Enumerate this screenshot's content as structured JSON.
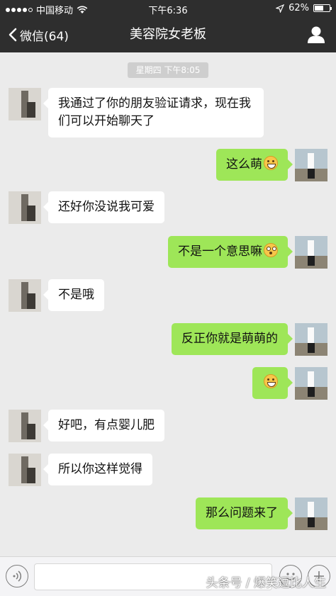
{
  "status_bar": {
    "carrier": "中国移动",
    "time": "下午6:36",
    "battery": "62%",
    "battery_level": 0.62
  },
  "nav": {
    "back_label": "微信(64)",
    "title": "美容院女老板",
    "profile_icon": "person-icon"
  },
  "timestamp": "星期四 下午8:05",
  "messages": [
    {
      "side": "in",
      "text": "我通过了你的朋友验证请求，现在我们可以开始聊天了"
    },
    {
      "side": "out",
      "text": "这么萌",
      "emoji": "grinning-face"
    },
    {
      "side": "in",
      "text": "还好你没说我可爱"
    },
    {
      "side": "out",
      "text": "不是一个意思嘛",
      "emoji": "surprised-face"
    },
    {
      "side": "in",
      "text": "不是哦"
    },
    {
      "side": "out",
      "text": "反正你就是萌萌的"
    },
    {
      "side": "out",
      "text": "",
      "emoji": "grinning-face"
    },
    {
      "side": "in",
      "text": "好吧，有点婴儿肥"
    },
    {
      "side": "in",
      "text": "所以你这样觉得"
    },
    {
      "side": "out",
      "text": "那么问题来了"
    }
  ],
  "input": {
    "value": "",
    "placeholder": ""
  },
  "watermark": "头条号 / 爆笑逗比人生",
  "colors": {
    "bar": "#2e2e2e",
    "chat_bg": "#ebebeb",
    "out_bubble": "#9ee658",
    "in_bubble": "#ffffff"
  }
}
